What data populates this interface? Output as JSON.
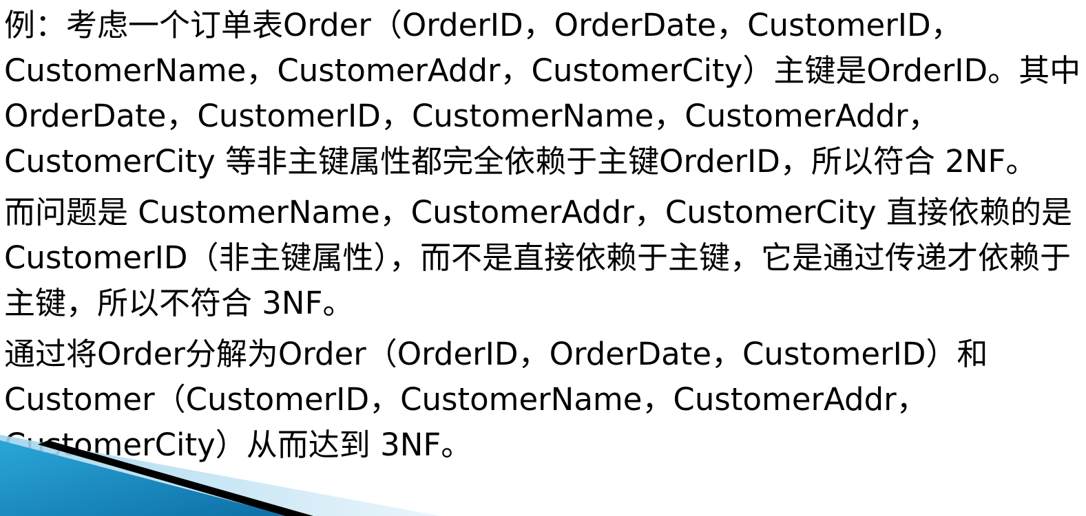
{
  "slide": {
    "paragraphs": [
      "例：考虑一个订单表Order（OrderID，OrderDate，CustomerID，CustomerName，CustomerAddr，CustomerCity）主键是OrderID。其中 OrderDate，CustomerID，CustomerName，CustomerAddr，CustomerCity 等非主键属性都完全依赖于主键OrderID，所以符合 2NF。",
      "而问题是 CustomerName，CustomerAddr，CustomerCity 直接依赖的是 CustomerID（非主键属性），而不是直接依赖于主键，它是通过传递才依赖于主键，所以不符合 3NF。",
      "通过将Order分解为Order（OrderID，OrderDate，CustomerID）和Customer（CustomerID，CustomerName，CustomerAddr，CustomerCity）从而达到 3NF。"
    ]
  },
  "colors": {
    "text": "#000000",
    "background": "#ffffff",
    "accent_blue": "#1f8fc4",
    "accent_light": "#cfe8f5"
  }
}
